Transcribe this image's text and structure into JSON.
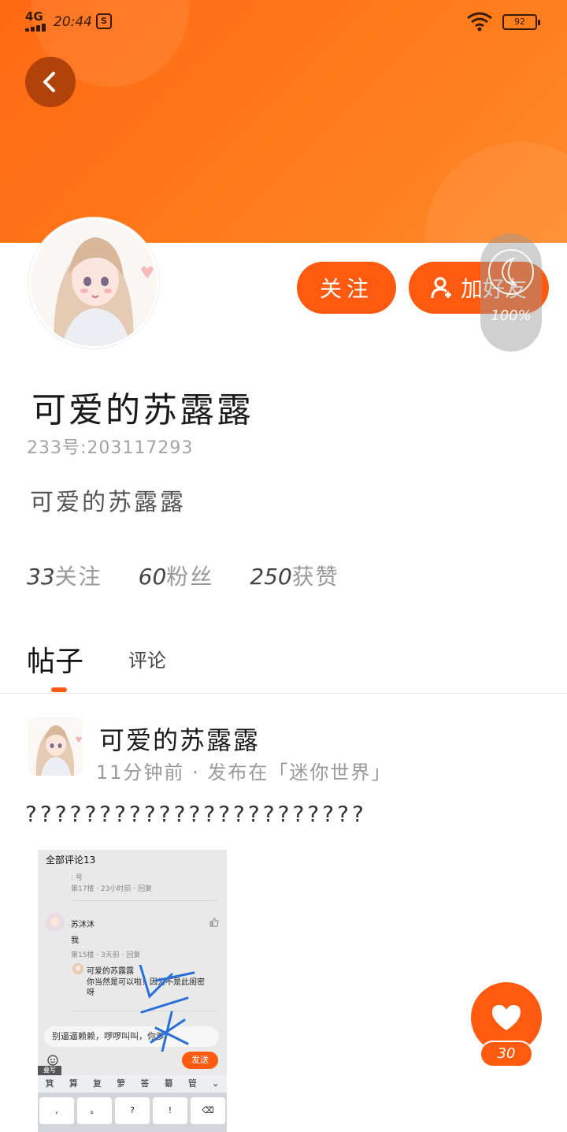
{
  "status_bar": {
    "network": "4G",
    "time": "20:44",
    "app_badge": "S",
    "battery": "92"
  },
  "profile": {
    "name": "可爱的苏露露",
    "id_line": "233号:203117293",
    "bio": "可爱的苏露露",
    "follow_button": "关注",
    "add_friend_button": "加好友",
    "stats": [
      {
        "value": "33",
        "label": "关注"
      },
      {
        "value": "60",
        "label": "粉丝"
      },
      {
        "value": "250",
        "label": "获赞"
      }
    ]
  },
  "overlay_widget": {
    "percent": "100%"
  },
  "tabs": [
    {
      "label": "帖子",
      "active": true
    },
    {
      "label": "评论",
      "active": false
    }
  ],
  "post": {
    "author": "可爱的苏露露",
    "meta": "11分钟前 · 发布在「迷你世界」",
    "text": "???????????????????????",
    "screenshot": {
      "title": "全部评论13",
      "floor_17_meta": "第17楼 · 23小时前 · 回复",
      "commenter": "苏沐沐",
      "comment": "我",
      "floor_15_meta": "第15楼 · 3天前 · 回复",
      "reply_author": "可爱的苏露露",
      "reply_text": "你当然是可以啦！因为不是此闺密呀",
      "input_text": "别逼逼赖赖，啰啰叫叫，你爹",
      "send": "发送",
      "draft": "叠写",
      "candidates": [
        "箕",
        "算",
        "复",
        "箩",
        "答",
        "纂",
        "管"
      ],
      "keys": [
        ",",
        "。",
        "?",
        "!"
      ]
    }
  },
  "like": {
    "count": "30"
  },
  "colors": {
    "accent": "#ff5a0f",
    "banner": "#ff7a1a"
  }
}
